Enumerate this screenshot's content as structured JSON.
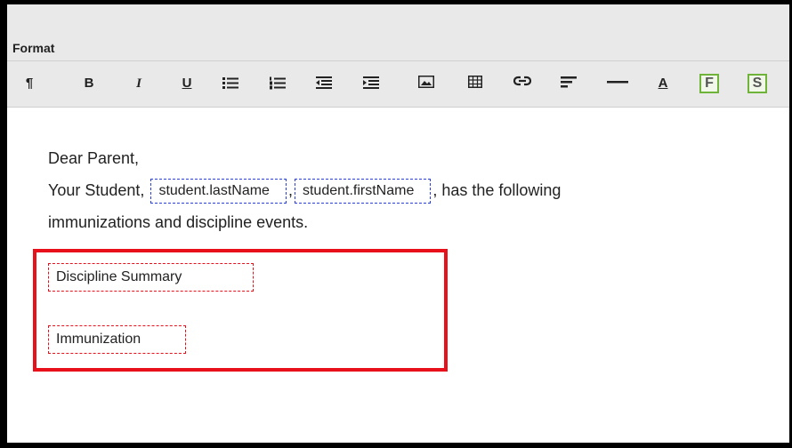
{
  "header": {
    "format_label": "Format"
  },
  "toolbar": {
    "paragraph": "¶",
    "bold": "B",
    "italic": "I",
    "underline": "U",
    "font_color": "A",
    "field_button": "F",
    "sub_report_button": "S"
  },
  "letter": {
    "greeting": "Dear Parent,",
    "line2_prefix": "Your Student, ",
    "field_last_name": "student.lastName",
    "separator": ",",
    "field_first_name": "student.firstName",
    "line2_suffix": ", has the following",
    "line3": "immunizations and discipline events."
  },
  "subreports": {
    "discipline": "Discipline Summary",
    "immunization": "Immunization"
  },
  "colors": {
    "highlight": "#e8101b",
    "field_border": "#2b3fe0",
    "toolbar_accent": "#6fb33a"
  }
}
